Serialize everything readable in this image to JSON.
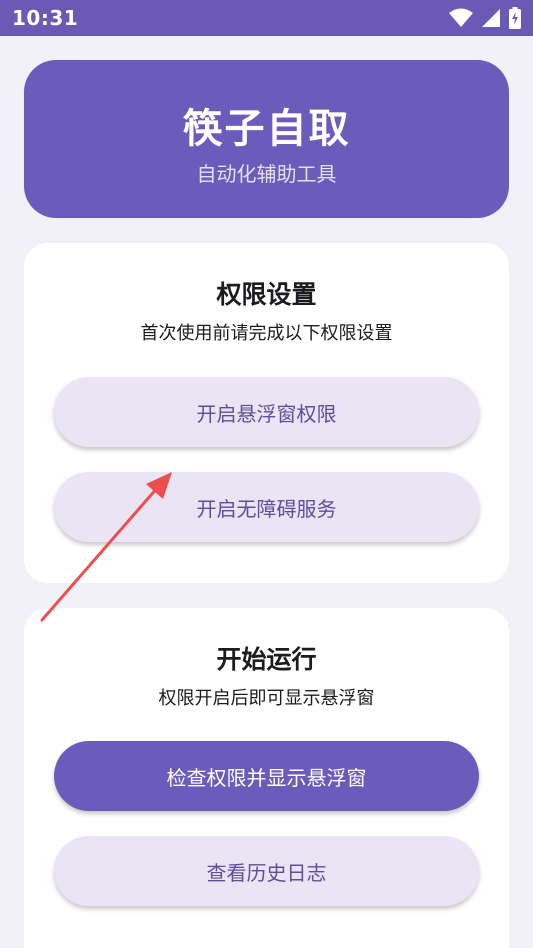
{
  "status_bar": {
    "time": "10:31",
    "icons": [
      "wifi-icon",
      "signal-icon",
      "battery-charging-icon"
    ]
  },
  "header": {
    "title": "筷子自取",
    "subtitle": "自动化辅助工具"
  },
  "permission_card": {
    "title": "权限设置",
    "description": "首次使用前请完成以下权限设置",
    "buttons": [
      {
        "label": "开启悬浮窗权限"
      },
      {
        "label": "开启无障碍服务"
      }
    ]
  },
  "run_card": {
    "title": "开始运行",
    "description": "权限开启后即可显示悬浮窗",
    "buttons": [
      {
        "label": "检查权限并显示悬浮窗"
      },
      {
        "label": "查看历史日志"
      }
    ]
  },
  "colors": {
    "primary": "#6b5bba",
    "tonal_button": "#ebe4f4",
    "tonal_text": "#5c4f9e",
    "background": "#f3f1f8",
    "annotation_arrow": "#ee4e4e"
  }
}
